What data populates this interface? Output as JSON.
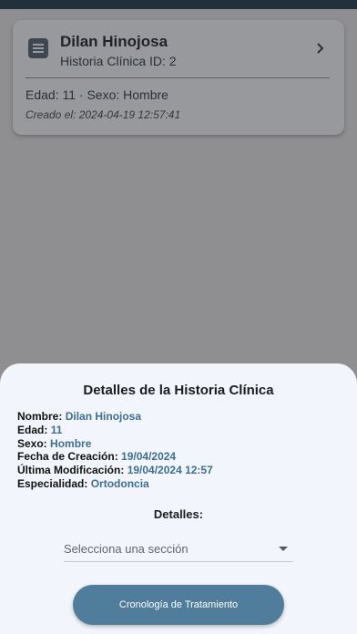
{
  "record": {
    "name": "Dilan Hinojosa",
    "subtitle": "Historia Clínica ID: 2",
    "age_sex": "Edad: 11 · Sexo: Hombre",
    "created": "Creado el: 2024-04-19 12:57:41"
  },
  "sheet": {
    "title": "Detalles de la Historia Clínica",
    "details": [
      {
        "key": "Nombre:",
        "value": "Dilan Hinojosa"
      },
      {
        "key": "Edad:",
        "value": "11"
      },
      {
        "key": "Sexo:",
        "value": "Hombre"
      },
      {
        "key": "Fecha de Creación:",
        "value": "19/04/2024"
      },
      {
        "key": "Última Modificación:",
        "value": "19/04/2024 12:57"
      },
      {
        "key": "Especialidad:",
        "value": "Ortodoncia"
      }
    ],
    "detalles_label": "Detalles:",
    "select_placeholder": "Selecciona una sección",
    "timeline_button": "Cronología de Tratamiento"
  },
  "icons": {
    "record": "document-icon",
    "chevron": "chevron-right-icon",
    "dropdown": "arrow-drop-down-icon"
  },
  "colors": {
    "accent": "#4f7d9b",
    "value_text": "#3d6f8f",
    "sheet_background": "#f2f5fb"
  }
}
